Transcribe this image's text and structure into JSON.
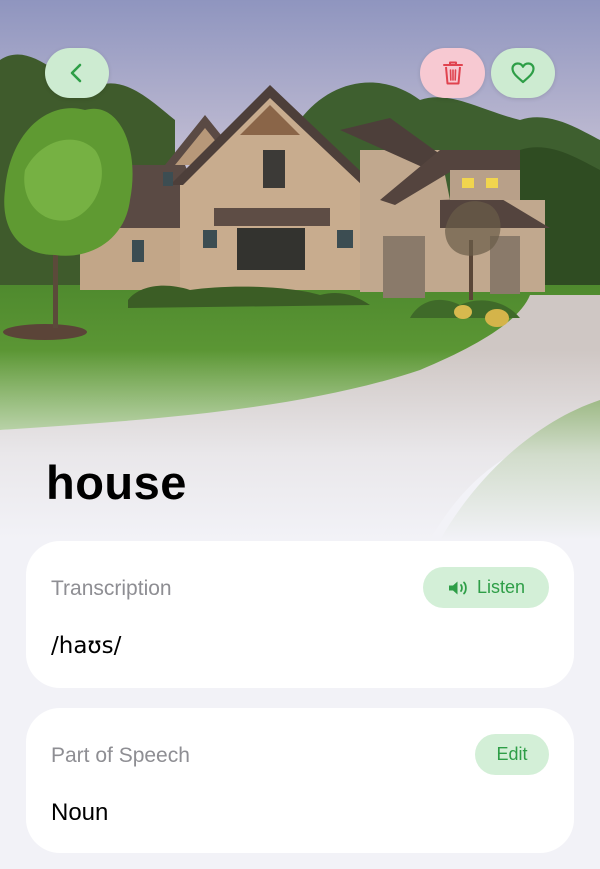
{
  "word": "house",
  "transcription": {
    "label": "Transcription",
    "value": "/haʊs/",
    "listen_label": "Listen"
  },
  "part_of_speech": {
    "label": "Part of Speech",
    "value": "Noun",
    "edit_label": "Edit"
  },
  "icons": {
    "back": "chevron-left-icon",
    "delete": "trash-icon",
    "favorite": "heart-icon",
    "speaker": "speaker-icon"
  },
  "colors": {
    "accent_green": "#2e9e47",
    "green_button_bg": "#cdebd1",
    "delete_red": "#e0434f",
    "delete_bg": "#f7c9d2",
    "card_bg": "#ffffff",
    "page_bg": "#f2f2f7"
  }
}
